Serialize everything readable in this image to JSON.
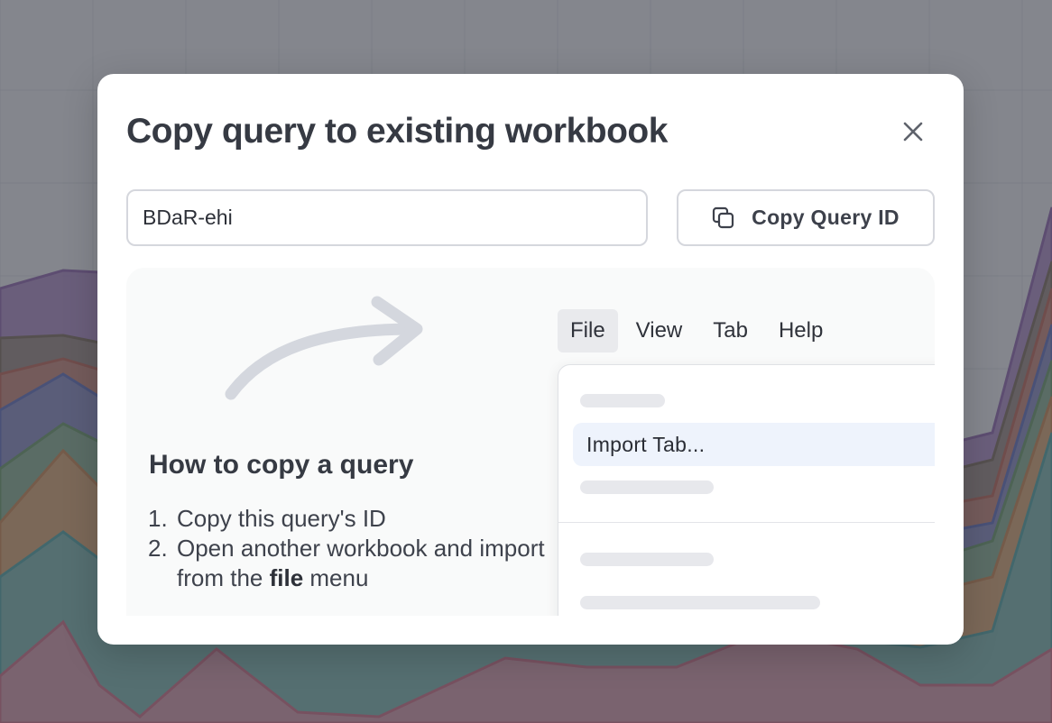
{
  "modal": {
    "title": "Copy query to existing workbook",
    "close_icon": "close-icon",
    "query_id_value": "BDaR-ehi",
    "copy_button_label": "Copy Query ID",
    "copy_button_icon": "copy-icon"
  },
  "howto": {
    "heading": "How to copy a query",
    "steps": [
      {
        "num": "1.",
        "text": "Copy this query's ID"
      },
      {
        "num": "2.",
        "text_before": "Open another workbook and import from the ",
        "bold": "file",
        "text_after": " menu"
      }
    ],
    "menu_bar": [
      "File",
      "View",
      "Tab",
      "Help"
    ],
    "active_menu": "File",
    "dropdown_highlight": "Import Tab..."
  },
  "colors": {
    "overlay": "#46485099",
    "modal_bg": "#ffffff",
    "text_primary": "#363a43",
    "highlight_bg": "#eef3fc"
  }
}
